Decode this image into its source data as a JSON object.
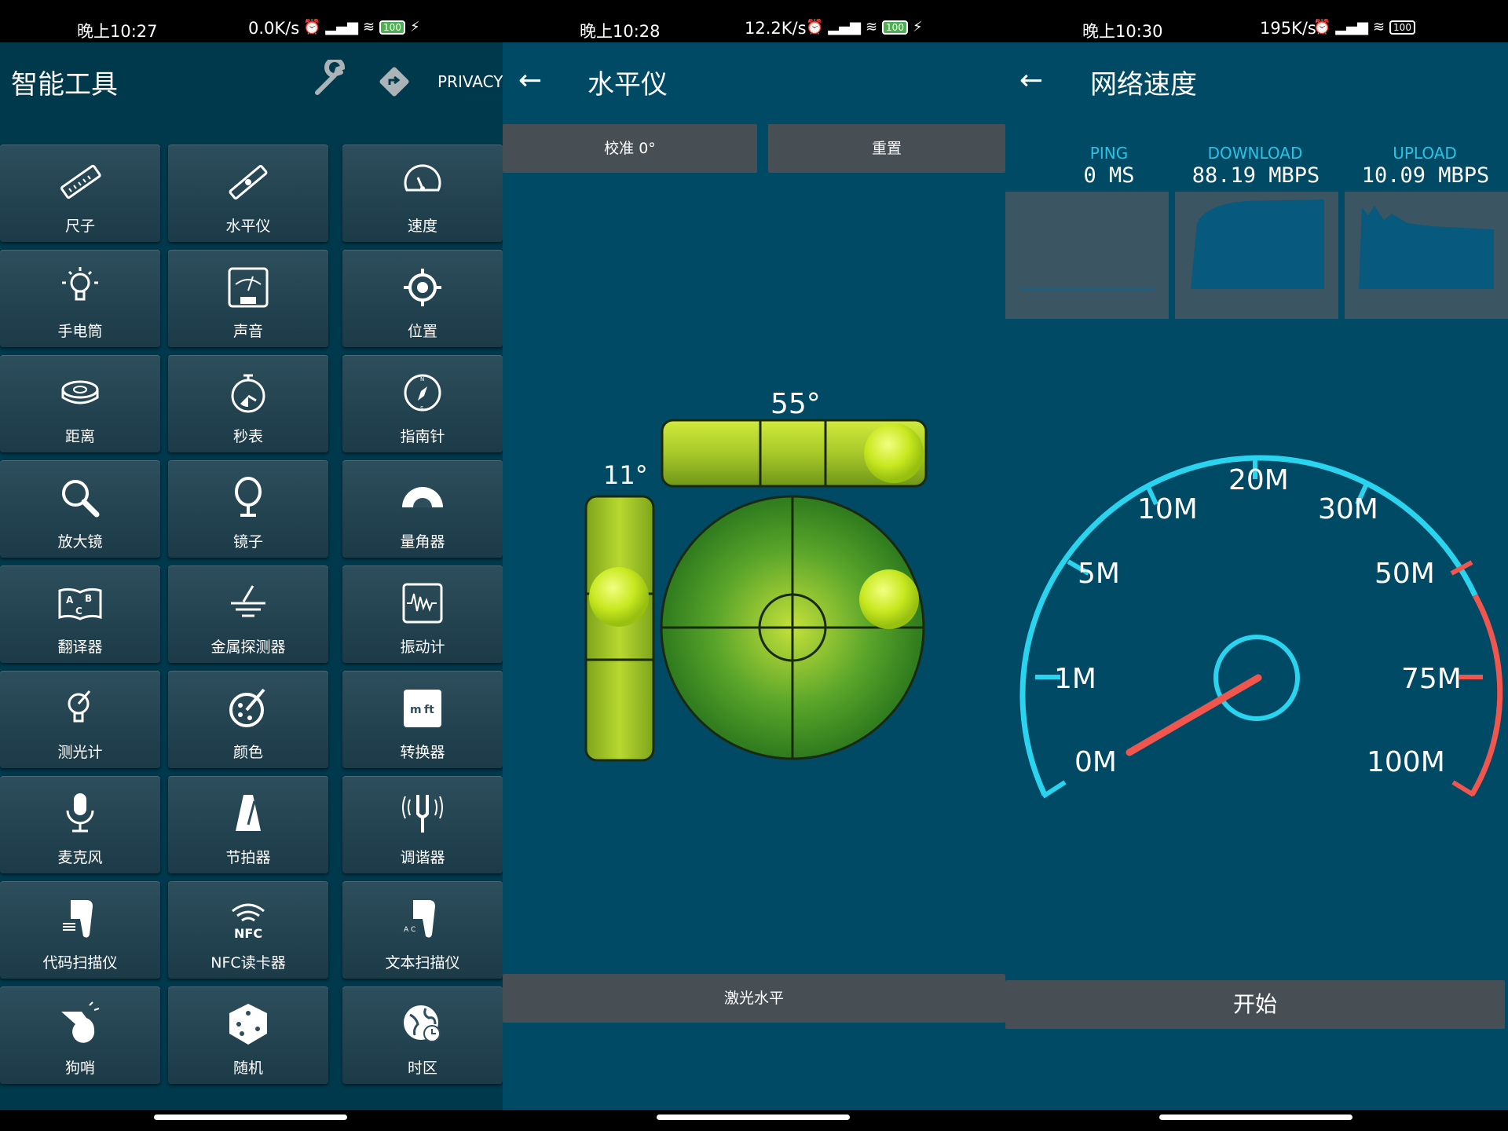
{
  "panels": {
    "tools": {
      "status": {
        "time": "晚上10:27",
        "speed": "0.0K/s",
        "battery": "100"
      },
      "title": "智能工具",
      "privacy": "PRIVACY",
      "tiles": [
        {
          "label": "尺子",
          "icon": "ruler-icon"
        },
        {
          "label": "水平仪",
          "icon": "level-icon"
        },
        {
          "label": "速度",
          "icon": "speedometer-icon"
        },
        {
          "label": "手电筒",
          "icon": "flashlight-icon"
        },
        {
          "label": "声音",
          "icon": "decibel-meter-icon"
        },
        {
          "label": "位置",
          "icon": "location-icon"
        },
        {
          "label": "距离",
          "icon": "tape-measure-icon"
        },
        {
          "label": "秒表",
          "icon": "stopwatch-icon"
        },
        {
          "label": "指南针",
          "icon": "compass-icon"
        },
        {
          "label": "放大镜",
          "icon": "magnifier-icon"
        },
        {
          "label": "镜子",
          "icon": "mirror-icon"
        },
        {
          "label": "量角器",
          "icon": "protractor-icon"
        },
        {
          "label": "翻译器",
          "icon": "translator-icon"
        },
        {
          "label": "金属探测器",
          "icon": "metal-detector-icon"
        },
        {
          "label": "振动计",
          "icon": "vibrometer-icon"
        },
        {
          "label": "测光计",
          "icon": "light-meter-icon"
        },
        {
          "label": "颜色",
          "icon": "color-palette-icon"
        },
        {
          "label": "转换器",
          "icon": "unit-converter-icon"
        },
        {
          "label": "麦克风",
          "icon": "microphone-icon"
        },
        {
          "label": "节拍器",
          "icon": "metronome-icon"
        },
        {
          "label": "调谐器",
          "icon": "tuning-fork-icon"
        },
        {
          "label": "代码扫描仪",
          "icon": "barcode-scanner-icon"
        },
        {
          "label": "NFC读卡器",
          "icon": "nfc-icon"
        },
        {
          "label": "文本扫描仪",
          "icon": "text-scanner-icon"
        },
        {
          "label": "狗哨",
          "icon": "whistle-icon"
        },
        {
          "label": "随机",
          "icon": "dice-icon"
        },
        {
          "label": "时区",
          "icon": "timezone-globe-icon"
        }
      ]
    },
    "level": {
      "status": {
        "time": "晚上10:28",
        "speed": "12.2K/s",
        "battery": "100"
      },
      "title": "水平仪",
      "calibrate_label": "校准 0°",
      "reset_label": "重置",
      "horizontal_angle": "55°",
      "vertical_angle": "11°",
      "laser_label": "激光水平"
    },
    "speed": {
      "status": {
        "time": "晚上10:30",
        "speed": "195K/s",
        "battery": "100"
      },
      "title": "网络速度",
      "ping_label": "PING",
      "ping_value": "0 MS",
      "download_label": "DOWNLOAD",
      "download_value": "88.19 MBPS",
      "upload_label": "UPLOAD",
      "upload_value": "10.09 MBPS",
      "gauge_ticks": [
        "0M",
        "1M",
        "5M",
        "10M",
        "20M",
        "30M",
        "50M",
        "75M",
        "100M"
      ],
      "start_label": "开始",
      "colors": {
        "arc": "#2ad3ee",
        "red_zone": "#f0554e",
        "needle": "#f0554e"
      }
    }
  }
}
